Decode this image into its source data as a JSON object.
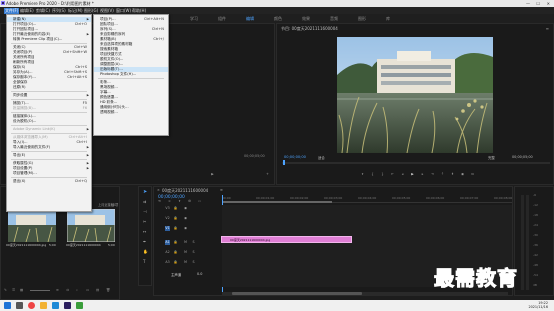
{
  "window": {
    "title": "Adobe Premiere Pro 2020 - D:\\利用图片素材 *",
    "minimize": "—",
    "maximize": "☐",
    "close": "✕"
  },
  "menubar": [
    {
      "label": "文件(F)",
      "active": true
    },
    {
      "label": "编辑(E)"
    },
    {
      "label": "剪辑(C)"
    },
    {
      "label": "序列(S)"
    },
    {
      "label": "标记(M)"
    },
    {
      "label": "图形(G)"
    },
    {
      "label": "视图(V)"
    },
    {
      "label": "窗口(W)"
    },
    {
      "label": "帮助(H)"
    }
  ],
  "workspace_tabs": [
    "学习",
    "组件",
    "编辑",
    "颜色",
    "效果",
    "音频",
    "图形",
    "库"
  ],
  "file_menu": {
    "items": [
      {
        "label": "新建(N)",
        "shortcut": "",
        "submenu": true,
        "highlight": true
      },
      {
        "label": "打开项目(O)...",
        "shortcut": "Ctrl+O"
      },
      {
        "label": "打开团队项目...",
        "shortcut": ""
      },
      {
        "label": "打开最近使用的内容(E)",
        "shortcut": "",
        "submenu": true
      },
      {
        "label": "转换 Premiere Clip 项目(C)...",
        "shortcut": ""
      },
      {
        "sep": true
      },
      {
        "label": "关闭(C)",
        "shortcut": "Ctrl+W"
      },
      {
        "label": "关闭项目(P)",
        "shortcut": "Ctrl+Shift+W"
      },
      {
        "label": "关闭所有项目",
        "shortcut": ""
      },
      {
        "label": "刷新所有项目",
        "shortcut": ""
      },
      {
        "label": "保存(S)",
        "shortcut": "Ctrl+S"
      },
      {
        "label": "另存为(A)...",
        "shortcut": "Ctrl+Shift+S"
      },
      {
        "label": "保存副本(Y)...",
        "shortcut": "Ctrl+Alt+S"
      },
      {
        "label": "全部保存",
        "shortcut": ""
      },
      {
        "label": "还原(R)",
        "shortcut": ""
      },
      {
        "sep": true
      },
      {
        "label": "同步设置",
        "shortcut": "",
        "submenu": true
      },
      {
        "sep": true
      },
      {
        "label": "捕捉(T)...",
        "shortcut": "F5"
      },
      {
        "label": "批量捕捉(B)...",
        "shortcut": "F6",
        "disabled": true
      },
      {
        "sep": true
      },
      {
        "label": "链接媒体(L)...",
        "shortcut": ""
      },
      {
        "label": "设为脱机(O)...",
        "shortcut": ""
      },
      {
        "sep": true
      },
      {
        "label": "Adobe Dynamic Link(K)",
        "shortcut": "",
        "submenu": true,
        "disabled": true
      },
      {
        "sep": true
      },
      {
        "label": "从媒体浏览器导入(M)",
        "shortcut": "Ctrl+Alt+I",
        "disabled": true
      },
      {
        "label": "导入(I)...",
        "shortcut": "Ctrl+I"
      },
      {
        "label": "导入最近使用的文件(F)",
        "shortcut": "",
        "submenu": true
      },
      {
        "sep": true
      },
      {
        "label": "导出(E)",
        "shortcut": "",
        "submenu": true
      },
      {
        "sep": true
      },
      {
        "label": "获取属性(G)",
        "shortcut": "",
        "submenu": true
      },
      {
        "label": "项目设置(P)",
        "shortcut": "",
        "submenu": true
      },
      {
        "label": "项目管理(M)...",
        "shortcut": ""
      },
      {
        "sep": true
      },
      {
        "label": "退出(X)",
        "shortcut": "Ctrl+Q"
      }
    ]
  },
  "new_submenu": {
    "items": [
      {
        "label": "项目(P)...",
        "shortcut": "Ctrl+Alt+N"
      },
      {
        "label": "团队项目...",
        "shortcut": ""
      },
      {
        "label": "序列(S)...",
        "shortcut": "Ctrl+N"
      },
      {
        "label": "来自剪辑的序列",
        "shortcut": ""
      },
      {
        "label": "素材箱(B)",
        "shortcut": "Ctrl+/"
      },
      {
        "label": "来自选择项的素材箱",
        "shortcut": ""
      },
      {
        "label": "搜索素材箱",
        "shortcut": ""
      },
      {
        "label": "项目快捷方式",
        "shortcut": ""
      },
      {
        "label": "脱机文件(O)...",
        "shortcut": ""
      },
      {
        "label": "调整图层(A)...",
        "shortcut": ""
      },
      {
        "label": "旧版标题(T)...",
        "shortcut": "",
        "highlight": true
      },
      {
        "label": "Photoshop 文件(H)...",
        "shortcut": ""
      },
      {
        "sep": true
      },
      {
        "label": "彩条...",
        "shortcut": ""
      },
      {
        "label": "黑场视频...",
        "shortcut": ""
      },
      {
        "label": "字幕...",
        "shortcut": ""
      },
      {
        "label": "颜色遮罩...",
        "shortcut": ""
      },
      {
        "label": "HD 彩条...",
        "shortcut": ""
      },
      {
        "label": "通用倒计时片头...",
        "shortcut": ""
      },
      {
        "label": "透明视频...",
        "shortcut": ""
      }
    ]
  },
  "program_monitor": {
    "title": "节目: 00度天2021111600004",
    "timecode_left": "00;00;00;00",
    "fit": "适合",
    "quality": "完整",
    "timecode_right": "00;00;05;00",
    "source_timecode": "00;00;00;00"
  },
  "project_panel": {
    "label": "上月近接触",
    "count": "0项",
    "clips": [
      {
        "name": "00度天2021111600004.jpg",
        "duration": "5;00"
      },
      {
        "name": "00度天2021111600004",
        "duration": "5;00"
      }
    ]
  },
  "timeline": {
    "tab": "00度天2021111600004",
    "timecode": "00;00;00;00",
    "ruler": [
      "00;00",
      "00;00;01;00",
      "00;00;02;00",
      "00;00;03;00",
      "00;00;04;00",
      "00;00;05;00",
      "00;00;06;00",
      "00;00;07;00",
      "00;00;08;00"
    ],
    "video_tracks": [
      "V3",
      "V2",
      "V1"
    ],
    "audio_tracks": [
      "A1",
      "A2",
      "A3"
    ],
    "master_label": "主声道",
    "master_value": "0.0",
    "clip_label": "00度天2021111600004.jpg",
    "clip_color": "#e07fd5"
  },
  "meter_scale": [
    "-6",
    "-12",
    "-18",
    "-24",
    "-30",
    "-36",
    "-42",
    "-48",
    "-54",
    "dB"
  ],
  "watermark": "最需教育",
  "taskbar": {
    "time": "19:22",
    "date": "2021/11/16",
    "icons": [
      "windows-icon",
      "search-icon",
      "chrome-icon",
      "files-icon",
      "ie-icon",
      "premiere-icon",
      "game-icon"
    ]
  }
}
